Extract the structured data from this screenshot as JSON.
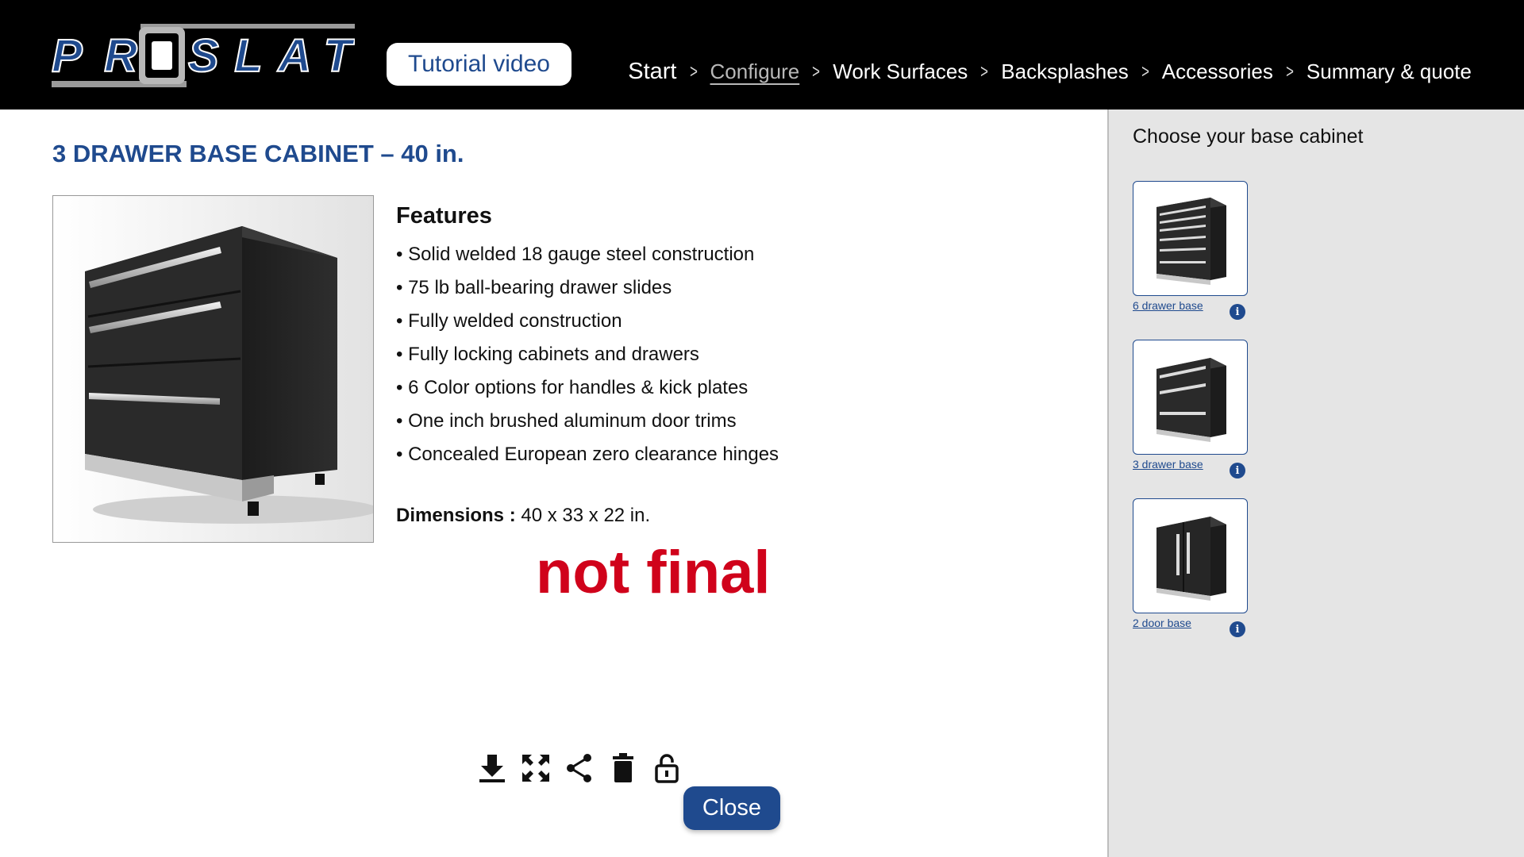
{
  "header": {
    "logo_text": "PROSLAT",
    "tutorial_label": "Tutorial video",
    "breadcrumb": [
      {
        "label": "Start"
      },
      {
        "label": "Configure"
      },
      {
        "label": "Work Surfaces"
      },
      {
        "label": "Backsplashes"
      },
      {
        "label": "Accessories"
      },
      {
        "label": "Summary & quote"
      }
    ],
    "active_step": "Configure",
    "separator": ">"
  },
  "product": {
    "title": "3 DRAWER BASE CABINET – 40 in.",
    "features_title": "Features",
    "features": [
      "Solid welded 18 gauge steel construction",
      "75 lb ball-bearing drawer slides",
      "Fully welded construction",
      "Fully locking cabinets and drawers",
      "6 Color options for handles & kick plates",
      "One inch brushed aluminum door trims",
      "Concealed European zero clearance hinges"
    ],
    "dimensions_label": "Dimensions :",
    "dimensions_value": "40 x 33 x 22 in.",
    "watermark": "not final"
  },
  "toolbar": {
    "icons": [
      "download-icon",
      "fullscreen-icon",
      "share-icon",
      "trash-icon",
      "unlock-icon"
    ],
    "close_label": "Close"
  },
  "sidebar": {
    "title": "Choose your base cabinet",
    "options": [
      {
        "label": "6 drawer base",
        "info": "i"
      },
      {
        "label": "3 drawer base",
        "info": "i"
      },
      {
        "label": "2 door base",
        "info": "i"
      }
    ]
  },
  "colors": {
    "brand_blue": "#1f4a8e",
    "header_bg": "#000000",
    "sidebar_bg": "#e5e5e5",
    "watermark_red": "#d0021b"
  }
}
